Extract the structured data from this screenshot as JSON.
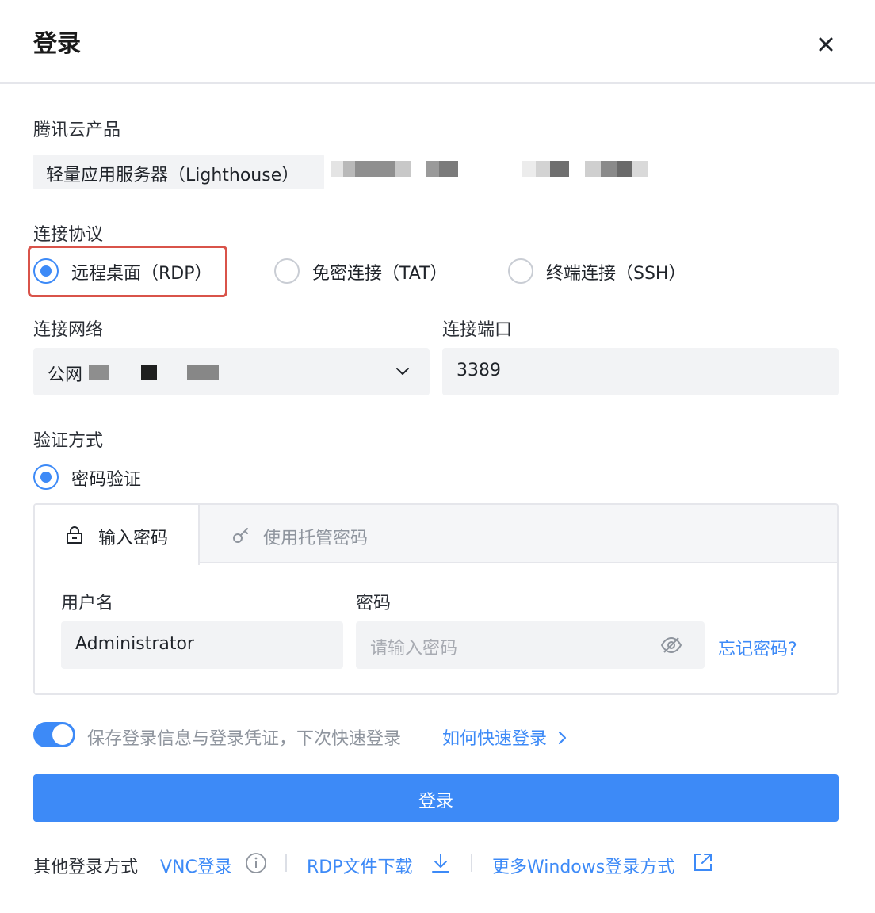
{
  "dialog": {
    "title": "登录",
    "close_icon": "close-icon"
  },
  "product": {
    "label": "腾讯云产品",
    "name": "轻量应用服务器（Lighthouse）"
  },
  "protocol": {
    "label": "连接协议",
    "options": [
      {
        "label": "远程桌面（RDP）",
        "checked": true
      },
      {
        "label": "免密连接（TAT）",
        "checked": false
      },
      {
        "label": "终端连接（SSH）",
        "checked": false
      }
    ]
  },
  "network": {
    "label": "连接网络",
    "value": "公网"
  },
  "port": {
    "label": "连接端口",
    "value": "3389"
  },
  "auth": {
    "label": "验证方式",
    "option": "密码验证",
    "tabs": [
      {
        "label": "输入密码",
        "icon": "lock-icon",
        "active": true
      },
      {
        "label": "使用托管密码",
        "icon": "key-icon",
        "active": false
      }
    ],
    "username_label": "用户名",
    "username_value": "Administrator",
    "password_label": "密码",
    "password_placeholder": "请输入密码",
    "forgot_link": "忘记密码?"
  },
  "remember": {
    "enabled": true,
    "text": "保存登录信息与登录凭证，下次快速登录",
    "help_link": "如何快速登录"
  },
  "login_button": "登录",
  "footer": {
    "label": "其他登录方式",
    "vnc_link": "VNC登录",
    "rdp_download_link": "RDP文件下载",
    "more_link": "更多Windows登录方式"
  },
  "colors": {
    "accent": "#3d8af7",
    "highlight": "#d9534a",
    "field_bg": "#f2f3f5"
  }
}
